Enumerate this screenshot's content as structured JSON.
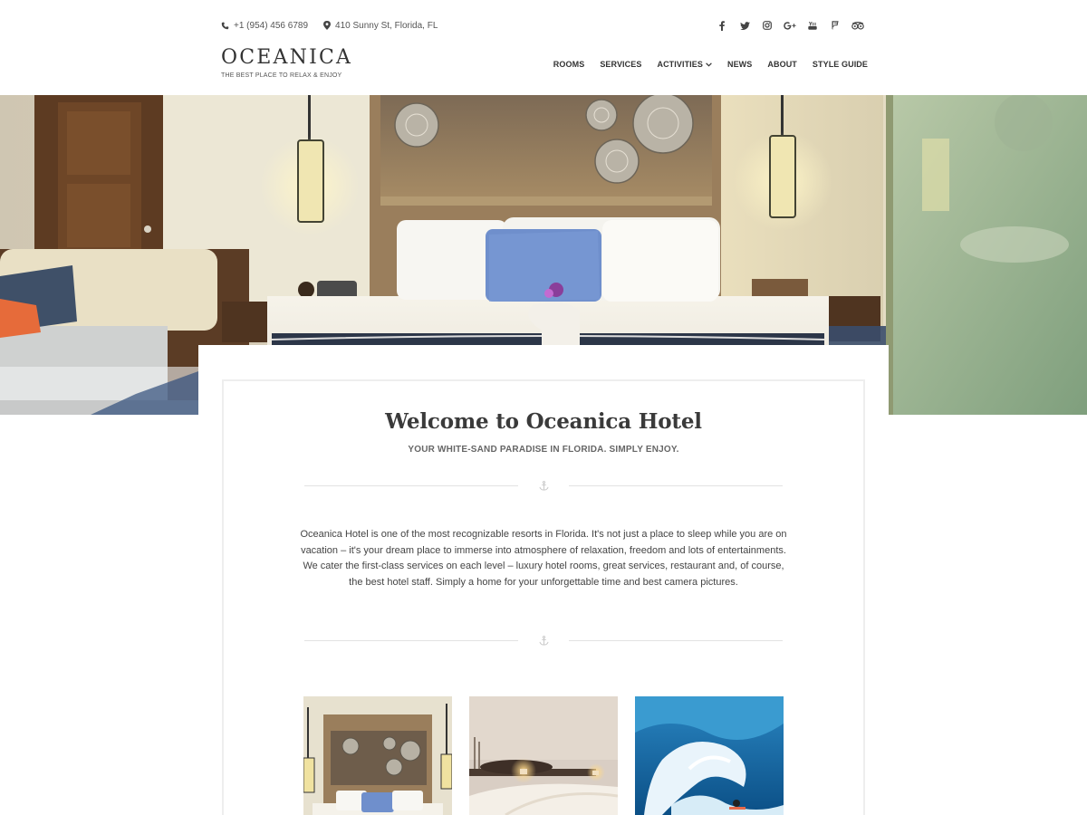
{
  "header": {
    "phone": "+1 (954) 456 6789",
    "address": "410 Sunny St, Florida, FL",
    "socials": [
      {
        "icon": "facebook-icon",
        "label": "f"
      },
      {
        "icon": "twitter-icon",
        "label": ""
      },
      {
        "icon": "instagram-icon",
        "label": ""
      },
      {
        "icon": "google-plus-icon",
        "label": "G+"
      },
      {
        "icon": "youtube-icon",
        "label": ""
      },
      {
        "icon": "foursquare-icon",
        "label": ""
      },
      {
        "icon": "tripadvisor-icon",
        "label": ""
      }
    ],
    "logo": "OCEANICA",
    "tagline": "THE BEST PLACE TO RELAX & ENJOY",
    "nav": [
      {
        "label": "ROOMS"
      },
      {
        "label": "SERVICES"
      },
      {
        "label": "ACTIVITIES",
        "has_dropdown": true
      },
      {
        "label": "NEWS"
      },
      {
        "label": "ABOUT"
      },
      {
        "label": "STYLE GUIDE"
      }
    ]
  },
  "hero": {
    "image": "hotel-bedroom-photo"
  },
  "welcome": {
    "title": "Welcome to Oceanica Hotel",
    "subtitle": "YOUR WHITE-SAND PARADISE IN FLORIDA. SIMPLY ENJOY.",
    "body": "Oceanica Hotel is one of the most recognizable resorts in Florida. It's not just a place to sleep while you are on vacation – it's your dream place to immerse into atmosphere of relaxation, freedom and lots of entertainments. We cater the first-class services on each level – luxury hotel rooms, great services, restaurant and, of course, the best hotel staff. Simply a home for your unforgettable time and best camera pictures."
  },
  "thumbnails": [
    {
      "image": "hotel-room-photo"
    },
    {
      "image": "spa-candles-photo"
    },
    {
      "image": "ocean-surfing-photo"
    }
  ],
  "colors": {
    "text": "#333333",
    "muted": "#666666",
    "divider": "#e2e2e2",
    "card_border": "#eeeeee",
    "wall_warm": "#e9e1c8",
    "wood": "#8a5a33",
    "pillow_blue": "#6f8fcc",
    "ocean": "#1a6fa8"
  }
}
